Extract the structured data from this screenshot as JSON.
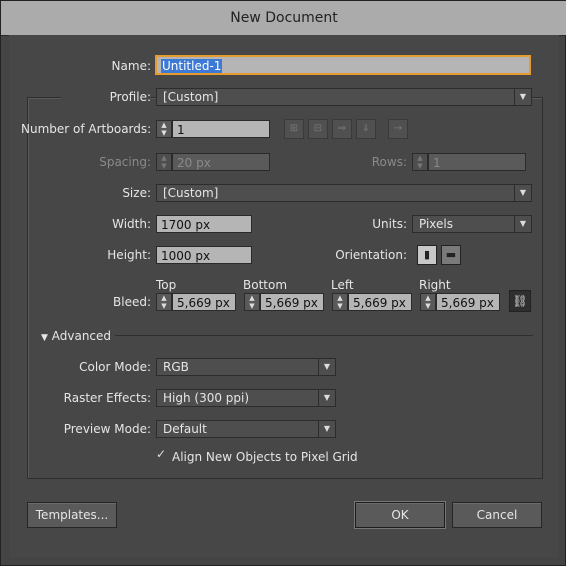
{
  "window": {
    "title": "New Document"
  },
  "name": {
    "label": "Name:",
    "value": "Untitled-1"
  },
  "profile": {
    "label": "Profile:",
    "value": "[Custom]"
  },
  "artboards": {
    "label": "Number of Artboards:",
    "value": "1"
  },
  "spacing": {
    "label": "Spacing:",
    "value": "20 px"
  },
  "rows": {
    "label": "Rows:",
    "value": "1"
  },
  "size": {
    "label": "Size:",
    "value": "[Custom]"
  },
  "width": {
    "label": "Width:",
    "value": "1700 px"
  },
  "units": {
    "label": "Units:",
    "value": "Pixels"
  },
  "height": {
    "label": "Height:",
    "value": "1000 px"
  },
  "orientation": {
    "label": "Orientation:",
    "selected": "portrait"
  },
  "bleed": {
    "label": "Bleed:",
    "top": {
      "label": "Top",
      "value": "5,669 px"
    },
    "bottom": {
      "label": "Bottom",
      "value": "5,669 px"
    },
    "left": {
      "label": "Left",
      "value": "5,669 px"
    },
    "right": {
      "label": "Right",
      "value": "5,669 px"
    }
  },
  "advanced": {
    "label": "Advanced",
    "color_mode": {
      "label": "Color Mode:",
      "value": "RGB"
    },
    "raster_effects": {
      "label": "Raster Effects:",
      "value": "High (300 ppi)"
    },
    "preview_mode": {
      "label": "Preview Mode:",
      "value": "Default"
    },
    "align_pixel_grid": {
      "label": "Align New Objects to Pixel Grid",
      "checked": true
    }
  },
  "buttons": {
    "templates": "Templates...",
    "ok": "OK",
    "cancel": "Cancel"
  },
  "icons": {
    "spin": "spin-arrows-icon",
    "dropdown": "chevron-down-icon",
    "checkbox": "checkmark-icon",
    "chain": "link-chain-icon",
    "arrangement": [
      "grid-by-row-icon",
      "grid-by-column-icon",
      "arrange-by-row-icon",
      "arrange-by-column-icon",
      "change-to-right-to-left-icon"
    ]
  },
  "colors": {
    "name_focus": "#e59b2d",
    "selection": "#3d7ad6"
  }
}
